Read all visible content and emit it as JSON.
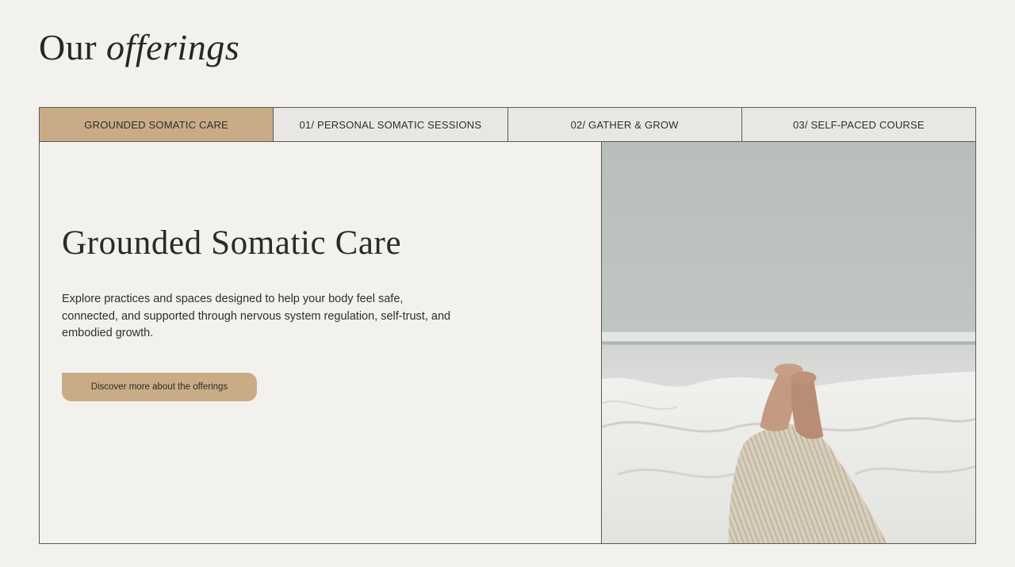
{
  "header": {
    "title_regular": "Our",
    "title_italic": "offerings"
  },
  "tabs": [
    {
      "label": "GROUNDED SOMATIC CARE",
      "active": true
    },
    {
      "label": "01/ PERSONAL SOMATIC SESSIONS",
      "active": false
    },
    {
      "label": "02/ GATHER & GROW",
      "active": false
    },
    {
      "label": "03/ SELF-PACED COURSE",
      "active": false
    }
  ],
  "panel": {
    "heading": "Grounded Somatic Care",
    "description": "Explore practices and spaces designed to help your body feel safe, connected, and supported through nervous system regulation, self-trust, and embodied growth.",
    "cta_label": "Discover more about the offerings"
  },
  "colors": {
    "background": "#f2f1ee",
    "accent": "#c9ac86",
    "tab_inactive": "#e8e7e3",
    "border": "#5a5a5a",
    "text": "#2b2b2b"
  }
}
